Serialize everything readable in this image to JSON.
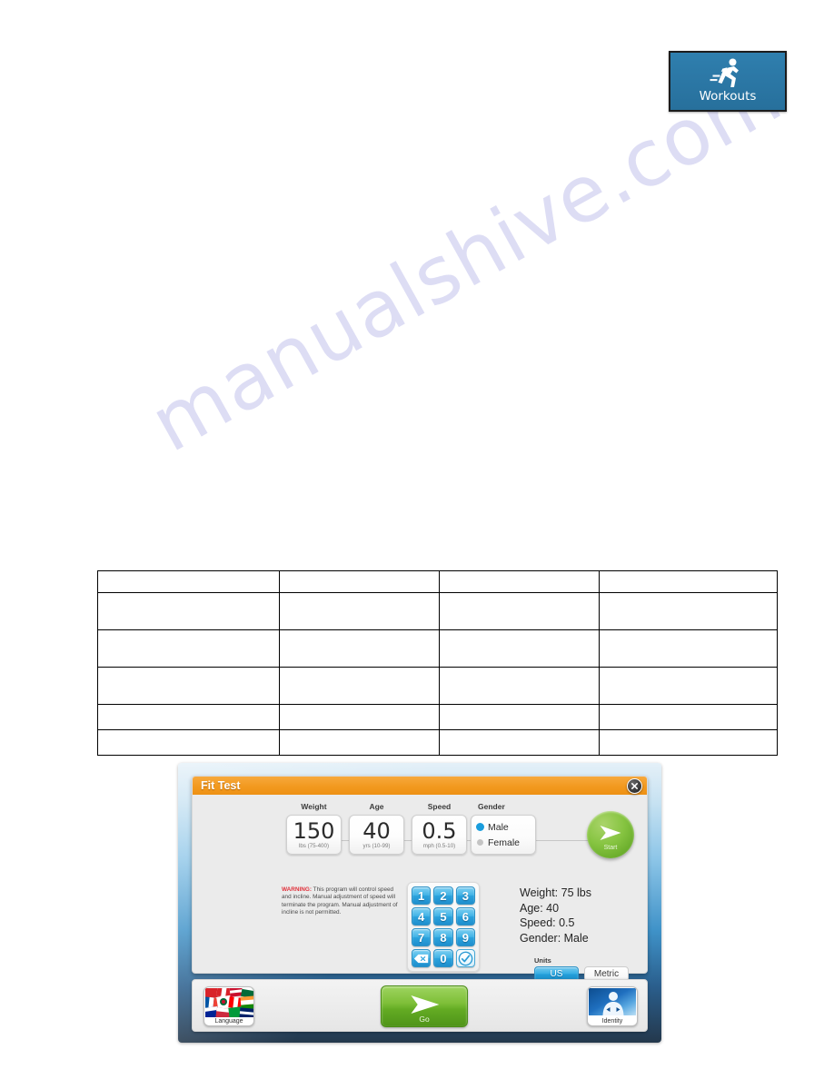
{
  "page": {
    "watermark": "manualshive.com"
  },
  "workouts_button": {
    "label": "Workouts",
    "icon": "runner-icon",
    "color": "#2b77a5"
  },
  "table": {
    "rows": [
      [
        "",
        "",
        "",
        ""
      ],
      [
        "",
        "",
        "",
        ""
      ],
      [
        "",
        "",
        "",
        ""
      ],
      [
        "",
        "",
        "",
        ""
      ],
      [
        "",
        "",
        "",
        ""
      ],
      [
        "",
        "",
        "",
        ""
      ]
    ]
  },
  "console": {
    "dialog": {
      "title": "Fit Test",
      "title_color": "#f2991f",
      "close_icon": "close-icon",
      "fields": [
        {
          "label": "Weight",
          "value": "150",
          "units": "lbs (75-400)"
        },
        {
          "label": "Age",
          "value": "40",
          "units": "yrs (10-99)"
        },
        {
          "label": "Speed",
          "value": "0.5",
          "units": "mph (0.5-10)"
        }
      ],
      "gender": {
        "label": "Gender",
        "options": [
          {
            "label": "Male",
            "selected": true
          },
          {
            "label": "Female",
            "selected": false
          }
        ]
      },
      "start_button": {
        "label": "Start",
        "icon": "play-arrow-icon",
        "color": "#7ebf38"
      },
      "warning": {
        "prefix": "WARNING:",
        "text": " This program will control speed and incline. Manual adjustment of speed will terminate the program. Manual adjustment of incline is not permitted.",
        "color": "#e0313b"
      },
      "keypad": {
        "keys": [
          "1",
          "2",
          "3",
          "4",
          "5",
          "6",
          "7",
          "8",
          "9"
        ],
        "backspace_icon": "backspace-icon",
        "zero": "0",
        "confirm_icon": "checkmark-icon",
        "key_color": "#2ba2dd"
      },
      "summary": {
        "weight": "Weight: 75 lbs",
        "age": "Age: 40",
        "speed": "Speed: 0.5",
        "gender": "Gender: Male"
      },
      "units": {
        "label": "Units",
        "options": [
          {
            "label": "US",
            "selected": true
          },
          {
            "label": "Metric",
            "selected": false
          }
        ]
      }
    },
    "tray": {
      "language_button": {
        "label": "Language",
        "icon": "flags-icon"
      },
      "go_button": {
        "label": "Go",
        "icon": "play-arrow-icon",
        "color": "#63ab23"
      },
      "identity_button": {
        "label": "Identity",
        "icon": "identity-person-icon"
      }
    }
  }
}
